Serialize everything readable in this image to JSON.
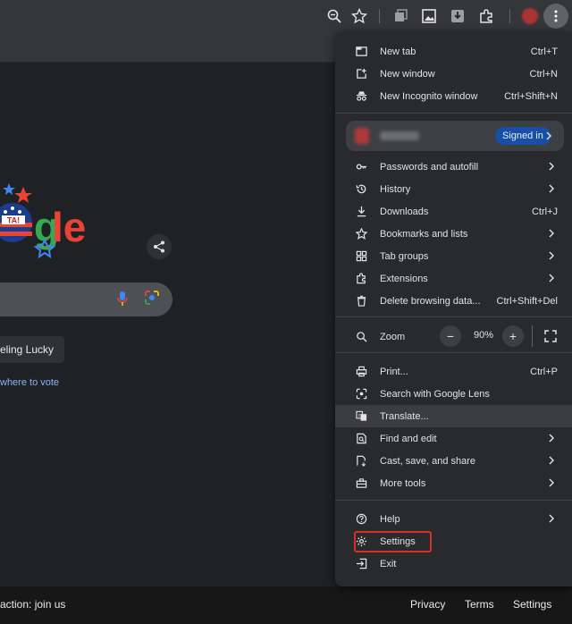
{
  "toolbar": {
    "icons": [
      "zoom-icon",
      "star-icon",
      "tab-search-icon",
      "image-icon",
      "download-icon",
      "extensions-icon",
      "avatar",
      "kebab-menu-icon"
    ]
  },
  "page": {
    "logo_text": "gle",
    "logo_badge": "TA!",
    "lucky_button": "eeling Lucky",
    "vote_link": "where to vote"
  },
  "footer": {
    "left_text": "action: join us",
    "privacy": "Privacy",
    "terms": "Terms",
    "settings": "Settings"
  },
  "menu": {
    "new_tab": {
      "label": "New tab",
      "shortcut": "Ctrl+T"
    },
    "new_window": {
      "label": "New window",
      "shortcut": "Ctrl+N"
    },
    "new_incognito": {
      "label": "New Incognito window",
      "shortcut": "Ctrl+Shift+N"
    },
    "profile": {
      "badge": "Signed in"
    },
    "passwords": {
      "label": "Passwords and autofill"
    },
    "history": {
      "label": "History"
    },
    "downloads": {
      "label": "Downloads",
      "shortcut": "Ctrl+J"
    },
    "bookmarks": {
      "label": "Bookmarks and lists"
    },
    "tab_groups": {
      "label": "Tab groups"
    },
    "extensions": {
      "label": "Extensions"
    },
    "delete_data": {
      "label": "Delete browsing data...",
      "shortcut": "Ctrl+Shift+Del"
    },
    "zoom": {
      "label": "Zoom",
      "minus": "−",
      "value": "90%",
      "plus": "+"
    },
    "print": {
      "label": "Print...",
      "shortcut": "Ctrl+P"
    },
    "lens": {
      "label": "Search with Google Lens"
    },
    "translate": {
      "label": "Translate..."
    },
    "find_edit": {
      "label": "Find and edit"
    },
    "cast": {
      "label": "Cast, save, and share"
    },
    "more_tools": {
      "label": "More tools"
    },
    "help": {
      "label": "Help"
    },
    "settings": {
      "label": "Settings"
    },
    "exit": {
      "label": "Exit"
    }
  },
  "colors": {
    "background": "#202124",
    "menu_bg": "#282a2d",
    "highlight_box": "#d93025",
    "signed_in_badge": "#174ea6",
    "link": "#8ab4f8"
  }
}
